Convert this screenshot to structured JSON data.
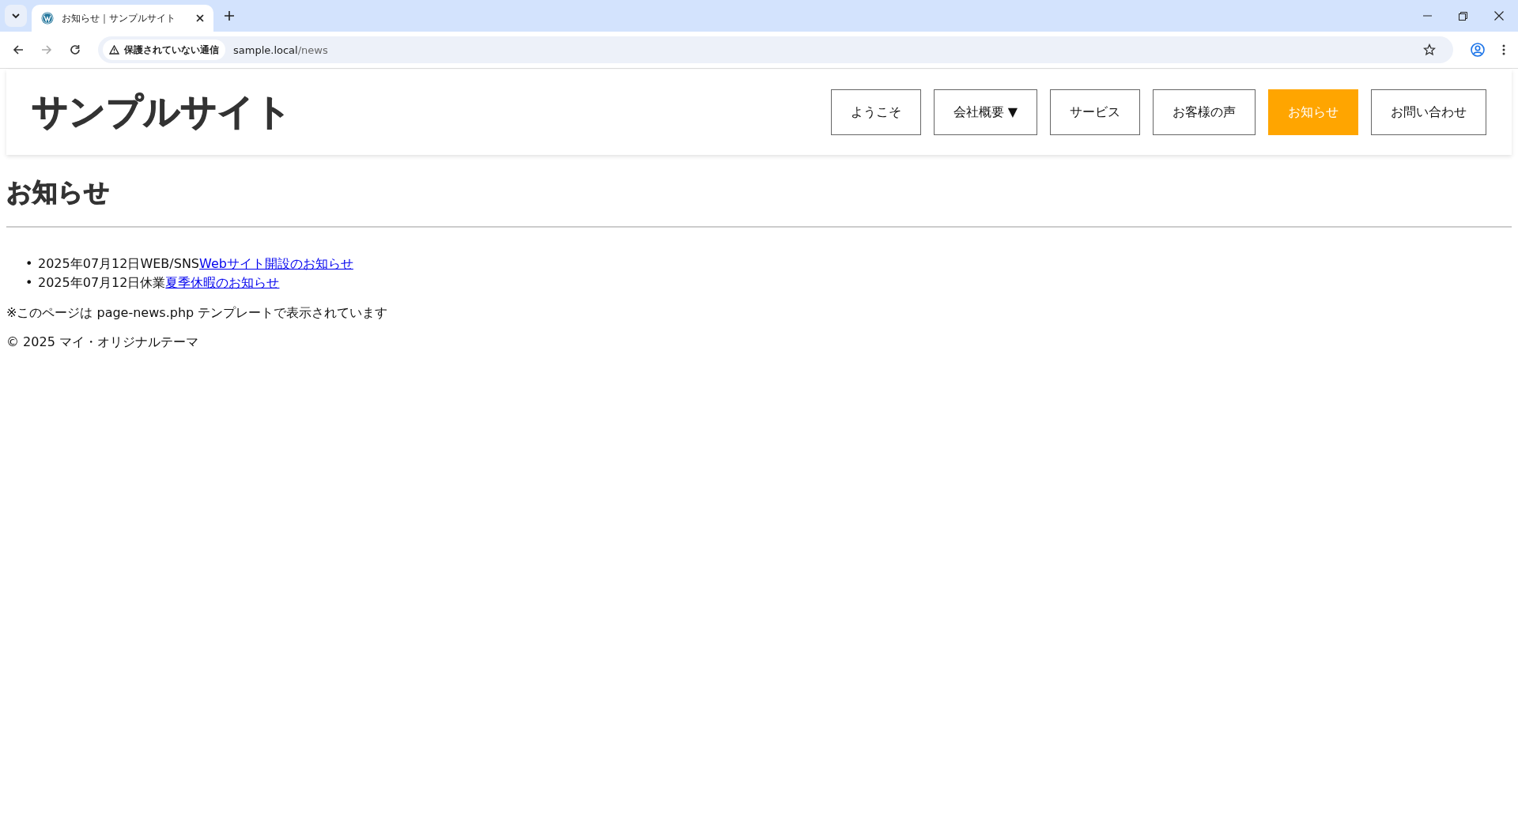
{
  "browser": {
    "tab": {
      "title": "お知らせ｜サンプルサイト"
    },
    "security_chip": "保護されていない通信",
    "url": {
      "host": "sample.local",
      "path": "/news"
    }
  },
  "site": {
    "logo": "サンプルサイト",
    "nav": [
      {
        "label": "ようこそ",
        "selected": false
      },
      {
        "label": "会社概要",
        "caret": "▼",
        "selected": false
      },
      {
        "label": "サービス",
        "selected": false
      },
      {
        "label": "お客様の声",
        "selected": false
      },
      {
        "label": "お知らせ",
        "selected": true
      },
      {
        "label": "お問い合わせ",
        "selected": false
      }
    ]
  },
  "page": {
    "heading": "お知らせ",
    "news": [
      {
        "bullet": "•",
        "date": "2025年07月12日",
        "category": "WEB/SNS",
        "title": "Webサイト開設のお知らせ"
      },
      {
        "bullet": "•",
        "date": "2025年07月12日",
        "category": "休業",
        "title": "夏季休暇のお知らせ"
      }
    ],
    "note": "※このページは page-news.php テンプレートで表示されています",
    "footer": "© 2025 マイ・オリジナルテーマ"
  }
}
